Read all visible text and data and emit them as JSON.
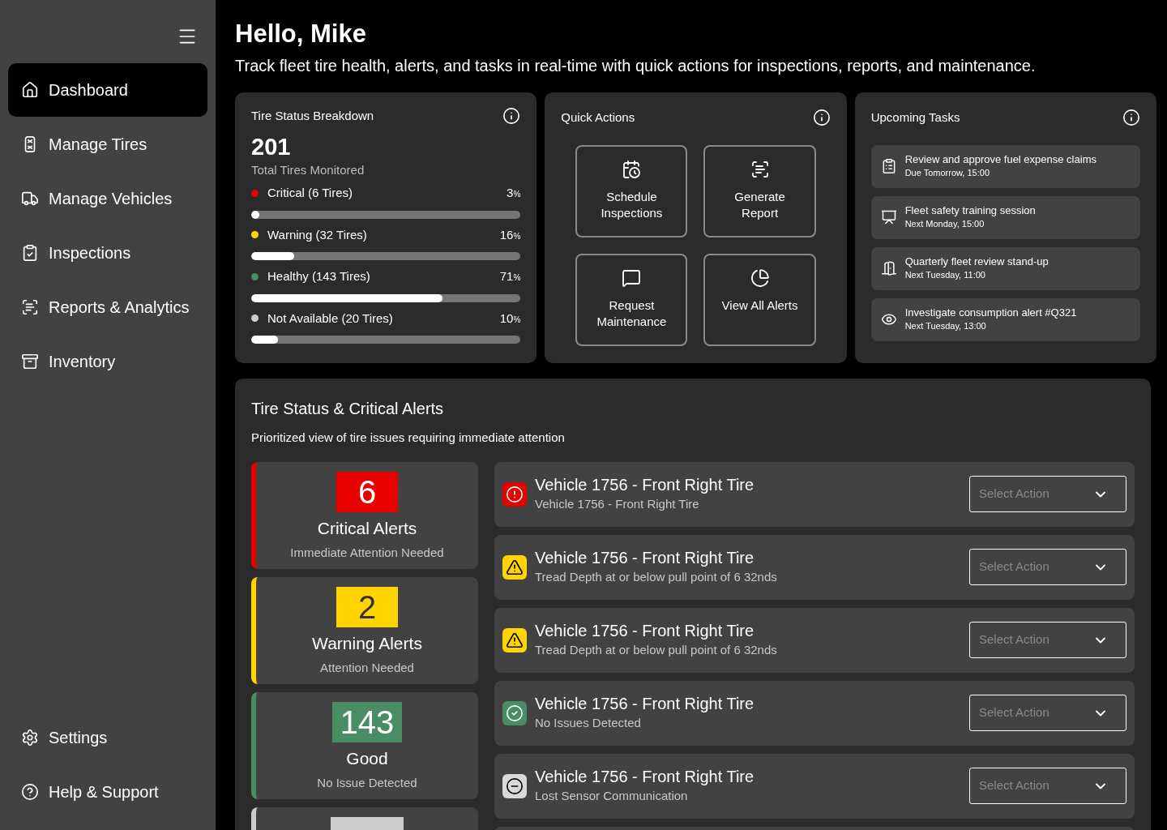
{
  "sidebar": {
    "items": [
      {
        "label": "Dashboard",
        "kind": "home",
        "selected": true
      },
      {
        "label": "Manage Tires",
        "kind": "tire",
        "selected": false
      },
      {
        "label": "Manage Vehicles",
        "kind": "truck",
        "selected": false
      },
      {
        "label": "Inspections",
        "kind": "clipboard",
        "selected": false
      },
      {
        "label": "Reports & Analytics",
        "kind": "report",
        "selected": false
      },
      {
        "label": "Inventory",
        "kind": "archive",
        "selected": false
      }
    ],
    "footer_items": [
      {
        "label": "Settings",
        "kind": "gear"
      },
      {
        "label": "Help & Support",
        "kind": "help"
      }
    ]
  },
  "header": {
    "title": "Hello, Mike",
    "subtitle": "Track fleet tire health, alerts, and tasks in real-time with quick actions for inspections, reports, and maintenance."
  },
  "tire_status": {
    "title": "Tire Status Breakdown",
    "total": "201",
    "total_label": "Total Tires Monitored",
    "rows": [
      {
        "label": "Critical (6 Tires)",
        "percent": "3",
        "unit": "%",
        "color": "#e60000",
        "level": 0.03
      },
      {
        "label": "Warning (32 Tires)",
        "percent": "16",
        "unit": "%",
        "color": "#ffd400",
        "level": 0.16
      },
      {
        "label": "Healthy (143 Tires)",
        "percent": "71",
        "unit": "%",
        "color": "#4a8c64",
        "level": 0.71
      },
      {
        "label": "Not Available (20 Tires)",
        "percent": "10",
        "unit": "%",
        "color": "#cccccc",
        "level": 0.1
      }
    ]
  },
  "quick_actions": {
    "title": "Quick Actions",
    "actions": [
      {
        "label": "Schedule Inspections",
        "kind": "calendar"
      },
      {
        "label": "Generate Report",
        "kind": "report"
      },
      {
        "label": "Request Maintenance",
        "kind": "message"
      },
      {
        "label": "View All Alerts",
        "kind": "alerts"
      }
    ]
  },
  "upcoming_tasks": {
    "title": "Upcoming Tasks",
    "tasks": [
      {
        "title": "Review and approve fuel expense claims",
        "time": "Due Tomorrow, 15:00",
        "kind": "clipboard"
      },
      {
        "title": "Fleet safety training session",
        "time": "Next Monday, 15:00",
        "kind": "presentation"
      },
      {
        "title": "Quarterly fleet review stand-up",
        "time": "Next Tuesday, 11:00",
        "kind": "door"
      },
      {
        "title": "Investigate consumption alert #Q321",
        "time": "Next Tuesday, 13:00",
        "kind": "eye"
      }
    ]
  },
  "alerts_panel": {
    "title": "Tire Status & Critical Alerts",
    "subtitle": "Prioritized view of tire issues requiring immediate attention",
    "summary": [
      {
        "count": "6",
        "label": "Critical Alerts",
        "sublabel": "Immediate Attention Needed",
        "color": "#e60000",
        "kind": "light"
      },
      {
        "count": "2",
        "label": "Warning Alerts",
        "sublabel": "Attention Needed",
        "color": "#ffd400",
        "kind": "dark"
      },
      {
        "count": "143",
        "label": "Good",
        "sublabel": "No Issue Detected",
        "color": "#4a8c64",
        "kind": "light"
      },
      {
        "color": "#cccccc",
        "kind": "dark"
      }
    ],
    "alerts": [
      {
        "kind": "critical",
        "title": "Vehicle 1756 - Front Right Tire",
        "detail": "Vehicle 1756 - Front Right Tire",
        "placeholder": "Select Action"
      },
      {
        "kind": "warning",
        "title": "Vehicle 1756 - Front Right Tire",
        "detail": "Tread Depth at or below pull point of 6 32nds",
        "placeholder": "Select Action"
      },
      {
        "kind": "warning",
        "title": "Vehicle 1756 - Front Right Tire",
        "detail": "Tread Depth at or below pull point of 6 32nds",
        "placeholder": "Select Action"
      },
      {
        "kind": "good",
        "title": "Vehicle 1756 - Front Right Tire",
        "detail": "No Issues Detected",
        "placeholder": "Select Action"
      },
      {
        "kind": "lost",
        "title": "Vehicle 1756 - Front Right Tire",
        "detail": "Lost Sensor Communication",
        "placeholder": "Select Action"
      },
      {
        "kind": "partial"
      }
    ]
  }
}
